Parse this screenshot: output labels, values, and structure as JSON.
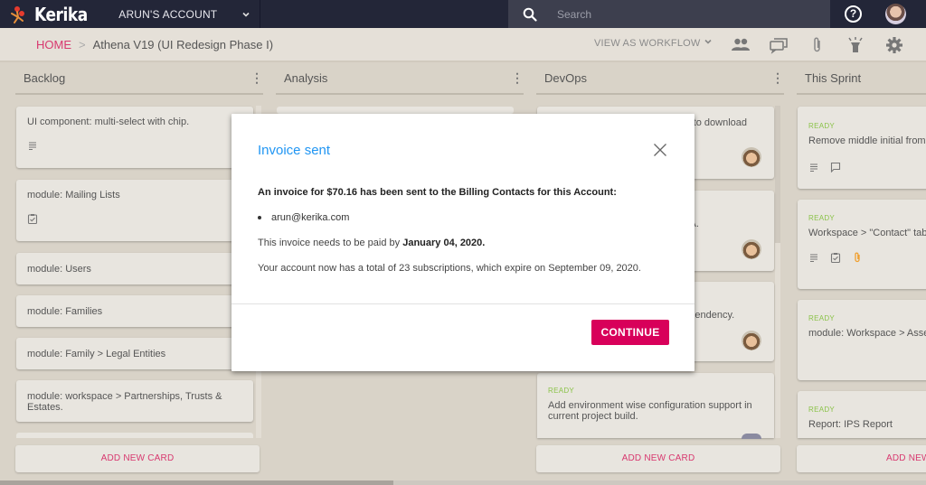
{
  "topbar": {
    "brand": "Kerika",
    "account": "ARUN'S ACCOUNT",
    "search_placeholder": "Search",
    "help_glyph": "?"
  },
  "breadcrumb": {
    "home": "HOME",
    "separator": ">",
    "title": "Athena V19 (UI Redesign Phase I)"
  },
  "toolbar": {
    "view_as": "VIEW AS WORKFLOW",
    "icons": [
      "people-icon",
      "chat-icon",
      "attachment-icon",
      "highlight-icon",
      "settings-icon"
    ]
  },
  "columns": [
    {
      "title": "Backlog",
      "cards": [
        {
          "text": "UI component: multi-select with chip.",
          "icons": [
            "description-icon"
          ]
        },
        {
          "text": "module: Mailing Lists",
          "icons": [
            "checklist-icon"
          ]
        },
        {
          "text": "module: Users"
        },
        {
          "text": "module: Families"
        },
        {
          "text": "module: Family > Legal Entities"
        },
        {
          "text": "module: workspace > Partnerships, Trusts & Estates."
        }
      ],
      "add_label": "ADD NEW CARD"
    },
    {
      "title": "Analysis",
      "cards": [],
      "add_label": ""
    },
    {
      "title": "DevOps",
      "cards": [
        {
          "text": "e to download",
          "avatar": true
        },
        {
          "text": "VA.",
          "avatar": true
        },
        {
          "text": "dependency.",
          "avatar": true
        },
        {
          "status": "READY",
          "text": "Add environment wise configuration support in current project build.",
          "avatar": true
        }
      ],
      "add_label": "ADD NEW CARD"
    },
    {
      "title": "This Sprint",
      "cards": [
        {
          "status": "READY",
          "text": "Remove middle initial from ",
          "icons": [
            "description-icon",
            "comment-icon"
          ]
        },
        {
          "status": "READY",
          "text": "Workspace > \"Contact\" tab.",
          "icons": [
            "description-icon",
            "checklist-icon",
            "attachment-icon"
          ]
        },
        {
          "status": "READY",
          "text": "module: Workspace > Asset"
        },
        {
          "status": "READY",
          "text": "Report: IPS Report"
        }
      ],
      "add_label": "ADD NEW"
    }
  ],
  "modal": {
    "title": "Invoice sent",
    "lead": "An invoice for $70.16 has been sent to the Billing Contacts for this Account:",
    "contacts": [
      "arun@kerika.com"
    ],
    "due_prefix": "This invoice needs to be paid by ",
    "due_date": "January 04, 2020.",
    "subscriptions": "Your account now has a total of 23 subscriptions, which expire on September 09, 2020.",
    "continue_label": "CONTINUE"
  },
  "colors": {
    "accent": "#d8005a",
    "link": "#d8386f",
    "title_blue": "#2196f3",
    "ready_green": "#8bc34a",
    "attachment_orange": "#f0a030"
  }
}
